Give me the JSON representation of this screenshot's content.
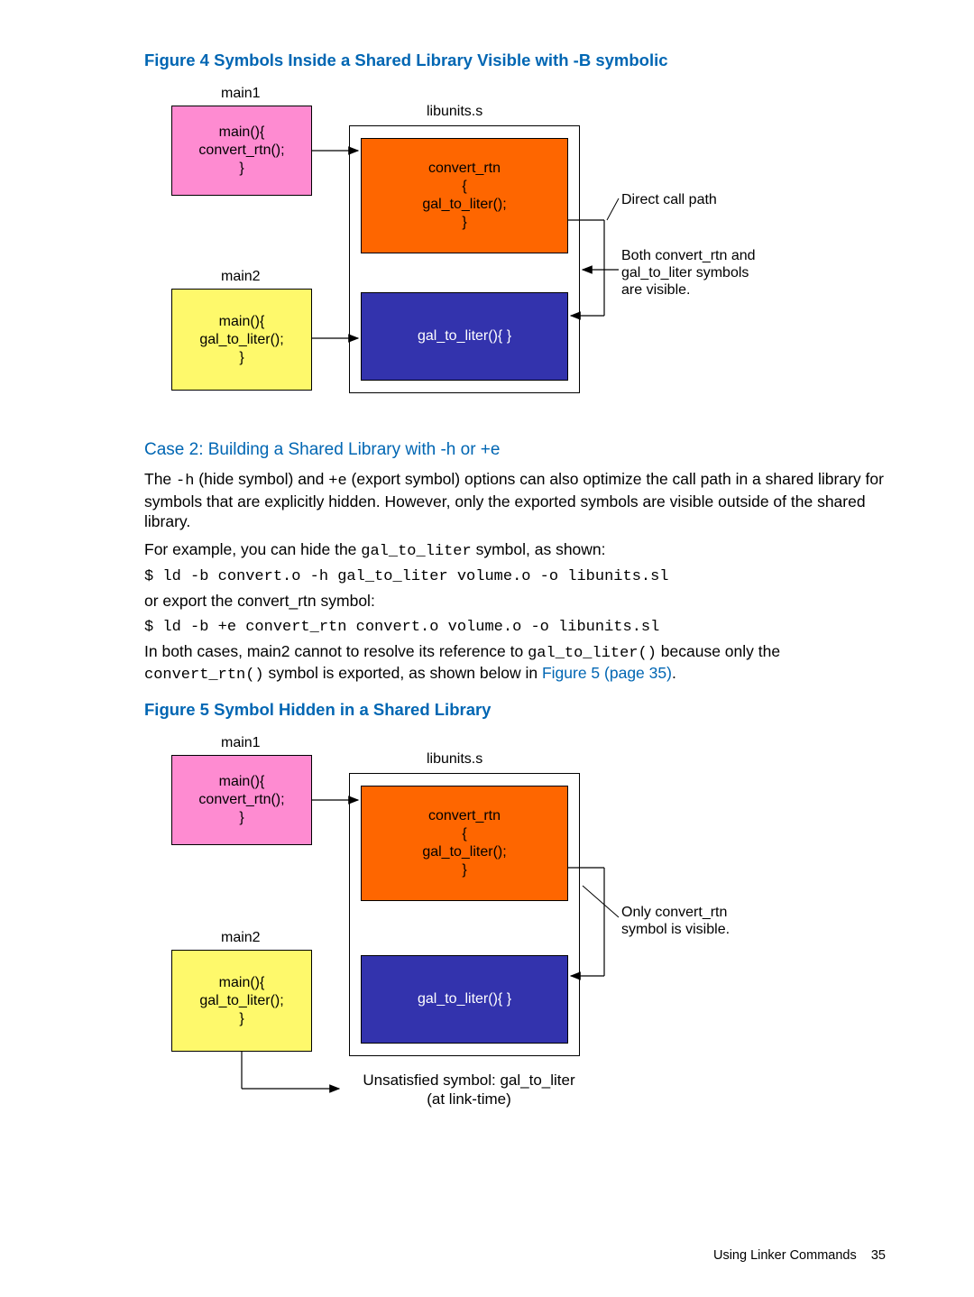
{
  "figure4": {
    "title": "Figure 4 Symbols Inside a Shared Library Visible with -B symbolic",
    "main1_label": "main1",
    "main1_code": "main(){\nconvert_rtn();\n}",
    "main2_label": "main2",
    "main2_code": "main(){\ngal_to_liter();\n}",
    "lib_label": "libunits.s",
    "convert_code": "convert_rtn\n{\ngal_to_liter();\n}",
    "gal_code": "gal_to_liter(){ }",
    "anno1": "Direct call path",
    "anno2": "Both convert_rtn and\ngal_to_liter symbols\nare visible."
  },
  "case2": {
    "heading": "Case 2: Building a Shared Library with -h or +e",
    "p1a": "The ",
    "p1_code1": "-h",
    "p1b": " (hide symbol) and ",
    "p1_code2": "+e",
    "p1c": " (export symbol) options can also optimize the call path in a shared library for symbols that are explicitly hidden. However, only the exported symbols are visible outside of the shared library.",
    "p2a": "For example, you can hide the ",
    "p2_code": "gal_to_liter",
    "p2b": " symbol, as shown:",
    "cmd1": "$ ld -b convert.o -h gal_to_liter volume.o -o libunits.sl",
    "p3": "or export the convert_rtn symbol:",
    "cmd2": "$ ld -b +e convert_rtn convert.o volume.o -o libunits.sl",
    "p4a": "In both cases, main2 cannot to resolve its reference to ",
    "p4_code1": "gal_to_liter()",
    "p4b": " because only the ",
    "p4_code2": "convert_rtn()",
    "p4c": " symbol is exported, as shown below in ",
    "p4_link": "Figure 5 (page 35)",
    "p4d": "."
  },
  "figure5": {
    "title": "Figure 5 Symbol Hidden in a Shared Library",
    "main1_label": "main1",
    "main1_code": "main(){\nconvert_rtn();\n}",
    "main2_label": "main2",
    "main2_code": "main(){\ngal_to_liter();\n}",
    "lib_label": "libunits.s",
    "convert_code": "convert_rtn\n{\ngal_to_liter();\n}",
    "gal_code": "gal_to_liter(){ }",
    "anno1": "Only convert_rtn\nsymbol is visible.",
    "bottom": "Unsatisfied symbol: gal_to_liter\n(at link-time)"
  },
  "footer": {
    "text": "Using Linker Commands",
    "page": "35"
  }
}
